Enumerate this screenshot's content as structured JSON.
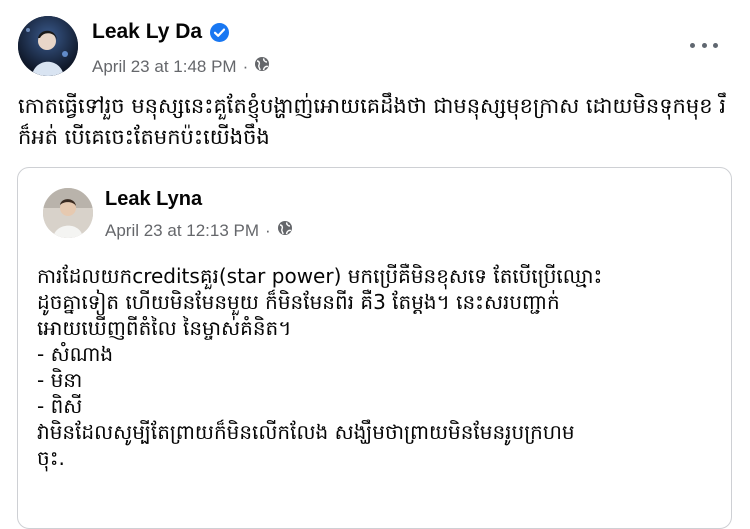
{
  "post": {
    "author": "Leak Ly Da",
    "date": "April 23 at 1:48 PM",
    "separator": "·",
    "caption": "កោតធ្វើទៅរួច មនុស្សនេះគួតែខ្ញុំបង្ហាញ់អោយគេដឹងថា ជាមនុស្សមុខក្រាស ដោយមិនទុកមុខ រឹក៏អត់ បើគេចេះតែមកប៉ះយើងចឹង",
    "icons": {
      "verified": "verified-badge-icon",
      "privacy": "globe-icon",
      "menu": "more-options-icon"
    },
    "accent": "#1877f2"
  },
  "shared": {
    "author": "Leak Lyna",
    "date": "April 23 at 12:13 PM",
    "separator": "·",
    "lines": [
      "ការដែលយកcreditsគួរ(star power) មកប្រើគឺមិនខុសទេ តែបើប្រើឈ្មោះ",
      "ដូចគ្នាទៀត ហើយមិនមែនមួយ ក៏មិនមែនពីរ គឺ3 តែម្តង។ នេះសរបញ្ជាក់",
      "អោយឃើញពីតំលៃ នៃម្ចាស់គំនិត។",
      "- សំណាង",
      "- មិនា",
      "- ពិសី",
      "វាមិនដែលសូម្បីតែព្រាយក៏មិនលើកលែង សង្ឃឹមថាព្រាយមិនមែនរូបក្រហម",
      "ចុះ."
    ]
  }
}
